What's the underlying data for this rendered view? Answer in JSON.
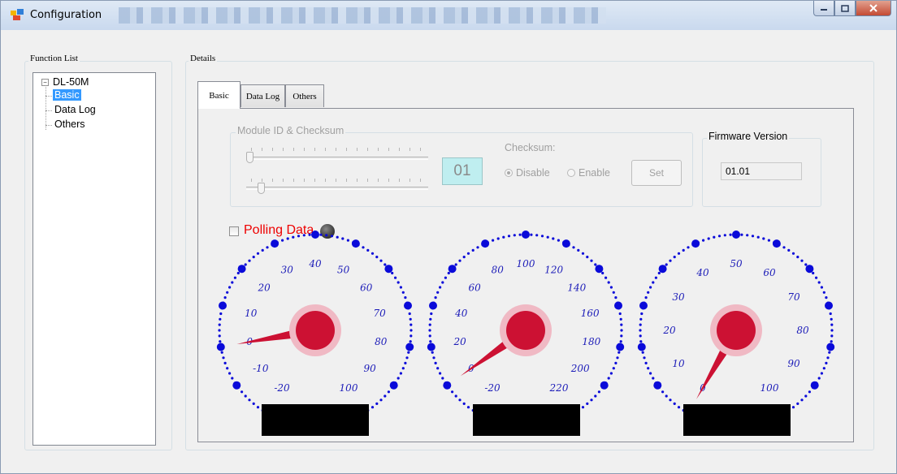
{
  "window": {
    "title": "Configuration"
  },
  "function_list": {
    "label": "Function List",
    "root": "DL-50M",
    "items": [
      {
        "label": "Basic",
        "selected": true
      },
      {
        "label": "Data Log",
        "selected": false
      },
      {
        "label": "Others",
        "selected": false
      }
    ]
  },
  "details": {
    "label": "Details",
    "tabs": [
      {
        "label": "Basic",
        "active": true
      },
      {
        "label": "Data Log",
        "active": false
      },
      {
        "label": "Others",
        "active": false
      }
    ]
  },
  "module": {
    "group_label": "Module ID & Checksum",
    "id_value": "01",
    "checksum_label": "Checksum:",
    "disable_label": "Disable",
    "enable_label": "Enable",
    "checksum_selected": "Disable",
    "set_label": "Set"
  },
  "firmware": {
    "group_label": "Firmware Version",
    "value": "01.01"
  },
  "polling": {
    "label": "Polling Data",
    "checked": false
  },
  "colors": {
    "accent": "#3399ff",
    "gauge_dots": "#0a0ad9",
    "needle": "#cc1133",
    "polling_text": "#ee0000"
  },
  "gauges": [
    {
      "labels": [
        "-20",
        "-10",
        "0",
        "10",
        "20",
        "30",
        "40",
        "50",
        "60",
        "70",
        "80",
        "90",
        "100"
      ],
      "needle_at": "0"
    },
    {
      "labels": [
        "-20",
        "0",
        "20",
        "40",
        "60",
        "80",
        "100",
        "120",
        "140",
        "160",
        "180",
        "200",
        "220"
      ],
      "needle_at": "0"
    },
    {
      "labels": [
        "0",
        "10",
        "20",
        "30",
        "40",
        "50",
        "60",
        "70",
        "80",
        "90",
        "100"
      ],
      "needle_at": "0"
    }
  ]
}
